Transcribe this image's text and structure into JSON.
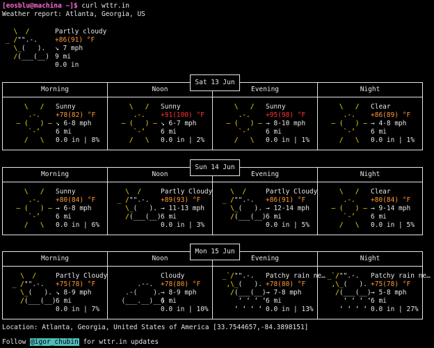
{
  "terminal": {
    "prompt": "[eosblu@machina ~]$",
    "command": "curl wttr.in",
    "report_title": "Weather report: Atlanta, Georgia, US"
  },
  "current": {
    "condition": "Partly cloudy",
    "temp": "+86(91) °F",
    "wind": "↘ 7 mph",
    "visibility": "9 mi",
    "precip": "0.0 in"
  },
  "days": [
    {
      "date": "Sat 13 Jun",
      "slots": [
        {
          "name": "Morning",
          "condition": "Sunny",
          "temp": "+78(82) °F",
          "wind": "↘ 6-8 mph",
          "vis": "6 mi",
          "precip": "0.0 in | 8%"
        },
        {
          "name": "Noon",
          "condition": "Sunny",
          "temp": "+91(100) °F",
          "wind": "↘ 6-7 mph",
          "vis": "6 mi",
          "precip": "0.0 in | 2%"
        },
        {
          "name": "Evening",
          "condition": "Sunny",
          "temp": "+95(98) °F",
          "wind": "→ 8-10 mph",
          "vis": "6 mi",
          "precip": "0.0 in | 1%"
        },
        {
          "name": "Night",
          "condition": "Clear",
          "temp": "+86(89) °F",
          "wind": "→ 4-8 mph",
          "vis": "6 mi",
          "precip": "0.0 in | 1%"
        }
      ]
    },
    {
      "date": "Sun 14 Jun",
      "slots": [
        {
          "name": "Morning",
          "condition": "Sunny",
          "temp": "+80(84) °F",
          "wind": "→ 6-8 mph",
          "vis": "6 mi",
          "precip": "0.0 in | 6%"
        },
        {
          "name": "Noon",
          "condition": "Partly Cloudy",
          "temp": "+89(93) °F",
          "wind": "→ 11-13 mph",
          "vis": "6 mi",
          "precip": "0.0 in | 3%"
        },
        {
          "name": "Evening",
          "condition": "Partly Cloudy",
          "temp": "+86(91) °F",
          "wind": "→ 12-14 mph",
          "vis": "6 mi",
          "precip": "0.0 in | 5%"
        },
        {
          "name": "Night",
          "condition": "Clear",
          "temp": "+80(84) °F",
          "wind": "→ 9-14 mph",
          "vis": "6 mi",
          "precip": "0.0 in | 5%"
        }
      ]
    },
    {
      "date": "Mon 15 Jun",
      "slots": [
        {
          "name": "Morning",
          "condition": "Partly Cloudy",
          "temp": "+75(78) °F",
          "wind": "↘ 8-9 mph",
          "vis": "6 mi",
          "precip": "0.0 in | 7%"
        },
        {
          "name": "Noon",
          "condition": "Cloudy",
          "temp": "+78(80) °F",
          "wind": "→ 8-9 mph",
          "vis": "6 mi",
          "precip": "0.0 in | 10%"
        },
        {
          "name": "Evening",
          "condition": "Patchy rain ne…",
          "temp": "+78(80) °F",
          "wind": "→ 7-8 mph",
          "vis": "6 mi",
          "precip": "0.0 in | 13%"
        },
        {
          "name": "Night",
          "condition": "Patchy rain ne…",
          "temp": "+75(78) °F",
          "wind": "→ 5-8 mph",
          "vis": "6 mi",
          "precip": "0.0 in | 27%"
        }
      ]
    }
  ],
  "footer": {
    "location": "Location: Atlanta, Georgia, United States of America [33.7544657,-84.3898151]",
    "follow_prefix": "Follow",
    "handle": "@igor_chubin",
    "follow_suffix": "for wttr.in updates"
  }
}
